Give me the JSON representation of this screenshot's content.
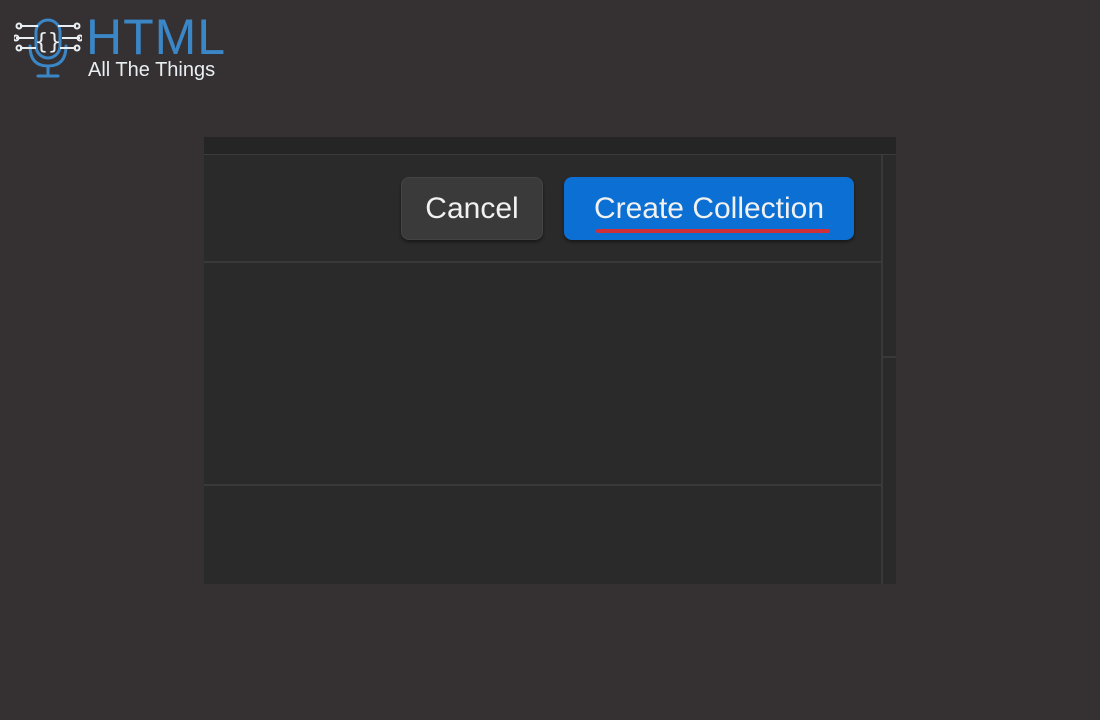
{
  "logo": {
    "title": "HTML",
    "subtitle": "All The Things",
    "icon": "microphone-circuit-icon",
    "title_color": "#3b86c6"
  },
  "dialog": {
    "cancel_label": "Cancel",
    "create_label": "Create Collection",
    "primary_color": "#0b6fd3",
    "highlight_color": "#d0303a"
  },
  "colors": {
    "background": "#353132",
    "panel": "#2b2a2b"
  }
}
